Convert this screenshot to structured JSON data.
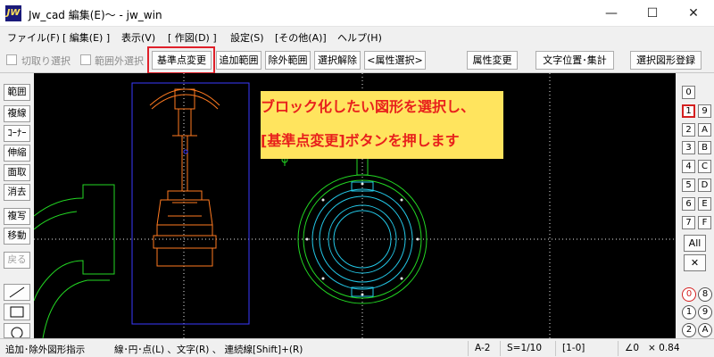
{
  "window": {
    "icon_text": "JW",
    "title": "Jw_cad 編集(E)〜 - jw_win",
    "controls": {
      "minimize": "—",
      "maximize": "☐",
      "close": "✕"
    }
  },
  "menu": [
    "ファイル(F)",
    "[ 編集(E) ]",
    "表示(V)",
    "[ 作図(D) ]",
    "設定(S)",
    "[その他(A)]",
    "ヘルプ(H)"
  ],
  "toolbar": {
    "checkboxes": [
      "切取り選択",
      "範囲外選択"
    ],
    "buttons": [
      "基準点変更",
      "追加範囲",
      "除外範囲",
      "選択解除",
      "<属性選択>",
      "属性変更",
      "文字位置･集計",
      "選択図形登録"
    ],
    "highlighted_button": "基準点変更"
  },
  "left_tools": [
    "範囲",
    "複線",
    "ｺｰﾅｰ",
    "伸縮",
    "面取",
    "消去",
    "複写",
    "移動",
    "戻る"
  ],
  "callout": {
    "line1": "ブロック化したい図形を選択し、",
    "line2": "[基準点変更]ボタンを押します"
  },
  "layers": {
    "top": "0",
    "left_column": [
      "1",
      "2",
      "3",
      "4",
      "5",
      "6",
      "7"
    ],
    "right_column": [
      "9",
      "A",
      "B",
      "C",
      "D",
      "E",
      "F"
    ],
    "all_label": "All",
    "x_label": "✕",
    "group_left": [
      "0",
      "1",
      "2"
    ],
    "group_right": [
      "8",
      "9",
      "A"
    ]
  },
  "status": {
    "message": "追加･除外図形指示",
    "hint": "線･円･点(L) 、文字(R) 、 連続線[Shift]+(R)",
    "paper": "A-2",
    "scale": "S=1/10",
    "layer": "[1-0]",
    "angle": "∠0",
    "factor": "× 0.84"
  },
  "colors": {
    "canvas_bg": "#000000",
    "selection_frame": "#3a3aff",
    "valve": "#ff7a20",
    "flange_outer": "#23d823",
    "flange_inner": "#23c8e8",
    "callout_bg": "#ffe45e",
    "callout_text": "#e8201c",
    "highlight": "#e0202a"
  }
}
